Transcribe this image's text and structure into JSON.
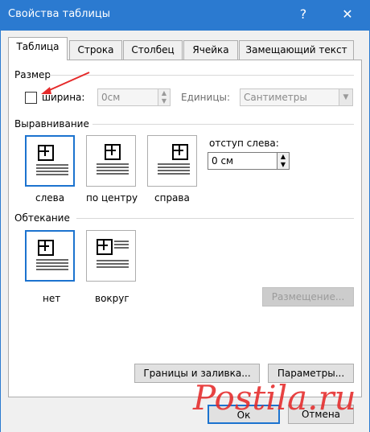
{
  "window": {
    "title": "Свойства таблицы",
    "help_glyph": "?",
    "close_glyph": "✕"
  },
  "tabs": [
    "Таблица",
    "Строка",
    "Столбец",
    "Ячейка",
    "Замещающий текст"
  ],
  "size": {
    "group": "Размер",
    "width_label": "ширина:",
    "width_value": "0см",
    "units_label": "Единицы:",
    "units_value": "Сантиметры"
  },
  "alignment": {
    "group": "Выравнивание",
    "options": [
      "слева",
      "по центру",
      "справа"
    ],
    "indent_label": "отступ слева:",
    "indent_value": "0 см"
  },
  "wrapping": {
    "group": "Обтекание",
    "options": [
      "нет",
      "вокруг"
    ],
    "placement_button": "Размещение..."
  },
  "buttons": {
    "borders": "Границы и заливка...",
    "params": "Параметры...",
    "ok": "Ок",
    "cancel": "Отмена"
  },
  "watermark": "Postila.ru",
  "colors": {
    "accent": "#2b7ad0",
    "selection": "#1c73cf",
    "arrow": "#e52a2a"
  }
}
